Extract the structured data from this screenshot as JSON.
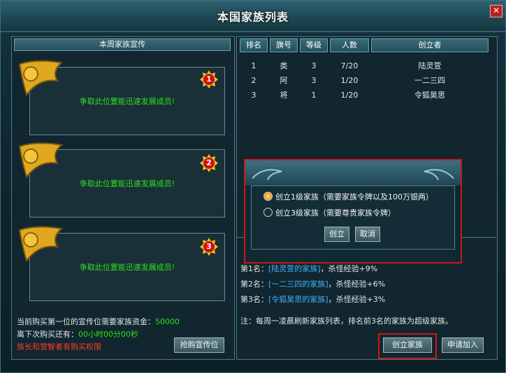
{
  "window": {
    "title": "本国家族列表",
    "close_label": "✕"
  },
  "left": {
    "header": "本周家族宣传",
    "slots": [
      {
        "rank": "1",
        "text": "争取此位置能迅速发展成员!"
      },
      {
        "rank": "2",
        "text": "争取此位置能迅速发展成员!"
      },
      {
        "rank": "3",
        "text": "争取此位置能迅速发展成员!"
      }
    ],
    "funds_label": "当前购买第一位的宣传位需要家族资金：",
    "funds_value": "50000",
    "countdown_label": "离下次购买还有：",
    "countdown_value": "00小时00分00秒",
    "permission_note": "族长和营智者有购买权限",
    "buy_button": "抢购宣传位"
  },
  "table": {
    "headers": [
      "排名",
      "旗号",
      "等级",
      "人数",
      "创立者"
    ],
    "rows": [
      [
        "1",
        "类",
        "3",
        "7/20",
        "陆灵萱"
      ],
      [
        "2",
        "阿",
        "3",
        "1/20",
        "一二三四"
      ],
      [
        "3",
        "将",
        "1",
        "1/20",
        "令狐昊思"
      ]
    ]
  },
  "announcements": [
    {
      "prefix": "第1名：",
      "family": "[陆灵萱的家族]",
      "suffix": "，杀怪经验+9%"
    },
    {
      "prefix": "第2名：",
      "family": "[一二三四的家族]",
      "suffix": "，杀怪经验+6%"
    },
    {
      "prefix": "第3名：",
      "family": "[令狐昊思的家族]",
      "suffix": "，杀怪经验+3%"
    }
  ],
  "note": "注：每周一凌晨刷新家族列表，排名前3名的家族为超级家族。",
  "buttons": {
    "create": "创立家族",
    "apply": "申请加入"
  },
  "dialog": {
    "option1": "创立1级家族（需要家族令牌以及100万银两）",
    "option2": "创立3级家族（需要尊贵家族令牌）",
    "selected": "option1",
    "ok": "创立",
    "cancel": "取消"
  },
  "colors": {
    "accent_green": "#2ee01a",
    "link_blue": "#3fb3ff",
    "warning_red": "#ff3b2f",
    "highlight_frame": "#d21414"
  }
}
